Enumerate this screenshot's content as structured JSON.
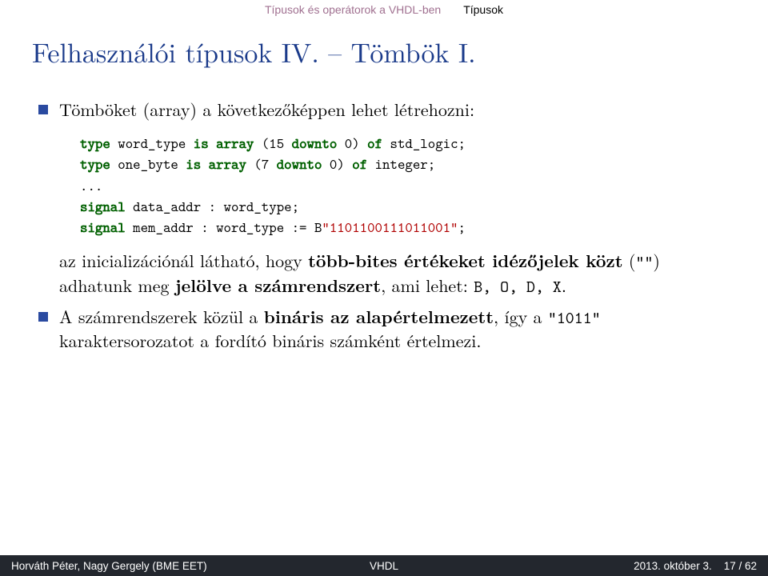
{
  "topbar": {
    "section": "Típusok és operátorok a VHDL-ben",
    "subsection": "Típusok"
  },
  "title": "Felhasználói típusok IV. – Tömbök I.",
  "bullets": {
    "intro": "Tömböket (array) a következőképpen lehet létrehozni:",
    "note_pre": "az inicializációnál látható, hogy ",
    "note_bold1": "több-bites értékeket idézőjelek közt",
    "note_mid1": " (",
    "note_tt1": "\"\"",
    "note_mid2": ") adhatunk meg ",
    "note_bold2": "jelölve a számrendszert",
    "note_mid3": ", ami lehet: ",
    "note_tt2": "B, O, D, X",
    "note_end": ".",
    "second_pre": "A számrendszerek közül a ",
    "second_bold": "bináris az alapértelmezett",
    "second_mid": ", így a ",
    "second_tt": "\"1011\"",
    "second_end": " karaktersorozatot a fordító bináris számként értelmezi."
  },
  "code": {
    "kw_type": "type",
    "kw_is": "is",
    "kw_array": "array",
    "kw_downto": "downto",
    "kw_of": "of",
    "kw_signal": "signal",
    "l1_a": " word_type ",
    "l1_b": " (15 ",
    "l1_c": " 0) ",
    "l1_d": " std_logic;",
    "l2_a": " one_byte ",
    "l2_b": " (7 ",
    "l2_c": " 0) ",
    "l2_d": " integer;",
    "l3": "...",
    "l4_a": " data_addr : word_type;",
    "l5_a": " mem_addr : word_type := B",
    "l5_str": "\"1101100111011001\"",
    "l5_b": ";"
  },
  "footer": {
    "left": "Horváth Péter, Nagy Gergely (BME EET)",
    "mid": "VHDL",
    "right_date": "2013. október 3.",
    "right_page": "17 / 62"
  }
}
